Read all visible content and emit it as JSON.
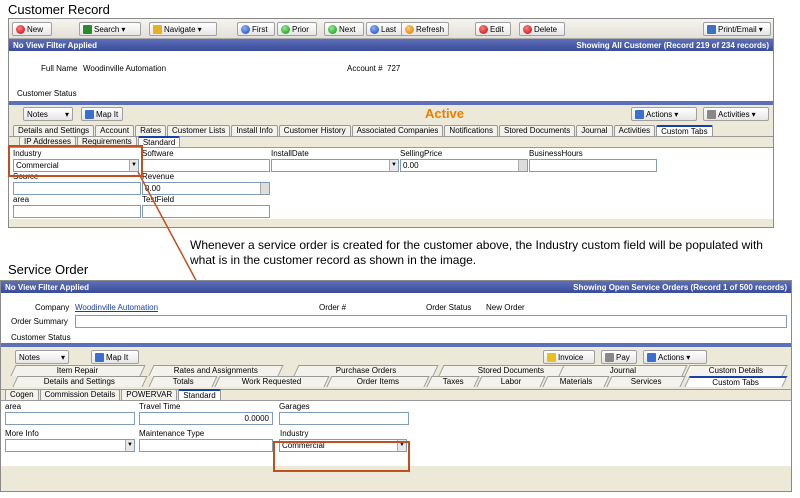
{
  "customer": {
    "section_title": "Customer Record",
    "toolbar": {
      "new": "New",
      "search": "Search",
      "navigate": "Navigate",
      "first": "First",
      "prior": "Prior",
      "next": "Next",
      "last": "Last",
      "refresh": "Refresh",
      "edit": "Edit",
      "delete": "Delete",
      "print_email": "Print/Email"
    },
    "filter_bar": {
      "left": "No View Filter Applied",
      "right": "Showing All Customer   (Record 219 of 234 records)"
    },
    "full_name_label": "Full Name",
    "full_name": "Woodinville Automation",
    "account_label": "Account #",
    "account": "727",
    "status_label": "Customer Status",
    "notes": "Notes",
    "map_it": "Map It",
    "status_value": "Active",
    "actions": "Actions",
    "activities": "Activities",
    "tabs": [
      "Details and Settings",
      "Account",
      "Rates",
      "Customer Lists",
      "Install Info",
      "Customer History",
      "Associated Companies",
      "Notifications",
      "Stored Documents",
      "Journal",
      "Activities",
      "Custom Tabs"
    ],
    "subtabs": [
      "IP Addresses",
      "Requirements",
      "Standard"
    ],
    "fields": {
      "industry_label": "Industry",
      "industry_value": "Commercial",
      "software_label": "Software",
      "installdate_label": "InstallDate",
      "sellingprice_label": "SellingPrice",
      "sellingprice_value": "0.00",
      "businesshours_label": "BusinessHours",
      "source_label": "Source",
      "revenue_label": "Revenue",
      "revenue_value": "0.00",
      "area_label": "area",
      "testfield_label": "TestField"
    }
  },
  "annotation": "Whenever a service order is created for the customer above, the Industry custom field will be populated with what is in the customer record as shown in the image.",
  "service": {
    "section_title": "Service Order",
    "filter_bar": {
      "left": "No View Filter Applied",
      "right": "Showing Open Service Orders   (Record 1 of 500 records)"
    },
    "company_label": "Company",
    "company": "Woodinville Automation",
    "order_label": "Order #",
    "order_status_label": "Order Status",
    "order_status": "New Order",
    "order_summary_label": "Order Summary",
    "status_label": "Customer Status",
    "notes": "Notes",
    "map_it": "Map It",
    "invoice": "Invoice",
    "pay": "Pay",
    "actions": "Actions",
    "tabs_back": [
      "Item Repair",
      "Rates and Assignments",
      "Purchase Orders",
      "Stored Documents",
      "Journal",
      "Custom Details"
    ],
    "tabs_front": [
      "Details and Settings",
      "Totals",
      "Work Requested",
      "Order Items",
      "Taxes",
      "Labor",
      "Materials",
      "Services",
      "Custom Tabs"
    ],
    "subtabs": [
      "Cogen",
      "Commission Details",
      "POWERVAR",
      "Standard"
    ],
    "fields": {
      "area_label": "area",
      "travel_label": "Travel Time",
      "travel_value": "0.0000",
      "garages_label": "Garages",
      "moreinfo_label": "More Info",
      "maint_label": "Maintenance Type",
      "industry_label": "Industry",
      "industry_value": "Commercial"
    }
  },
  "colors": {
    "highlight": "#c0501d",
    "active": "#f07c00",
    "bar": "#3a4c99"
  }
}
